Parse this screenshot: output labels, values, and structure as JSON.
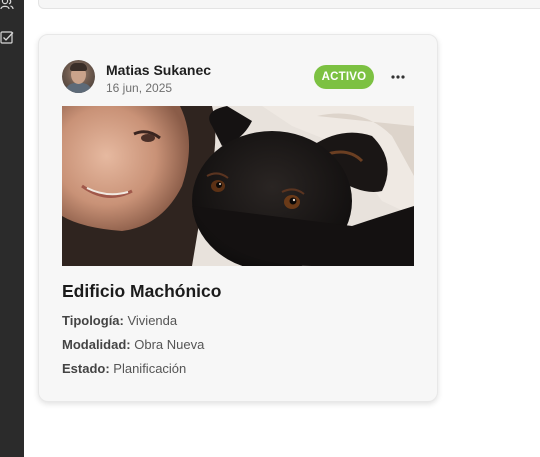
{
  "sidebar": {
    "items": [
      {
        "icon": "users-icon"
      },
      {
        "icon": "checklist-icon"
      }
    ]
  },
  "post": {
    "author": "Matias Sukanec",
    "date": "16 jun, 2025",
    "status": "ACTIVO",
    "status_color": "#7cc142",
    "title": "Edificio Machónico",
    "details": [
      {
        "label": "Tipología:",
        "value": " Vivienda"
      },
      {
        "label": "Modalidad:",
        "value": " Obra Nueva"
      },
      {
        "label": "Estado:",
        "value": " Planificación"
      }
    ]
  }
}
